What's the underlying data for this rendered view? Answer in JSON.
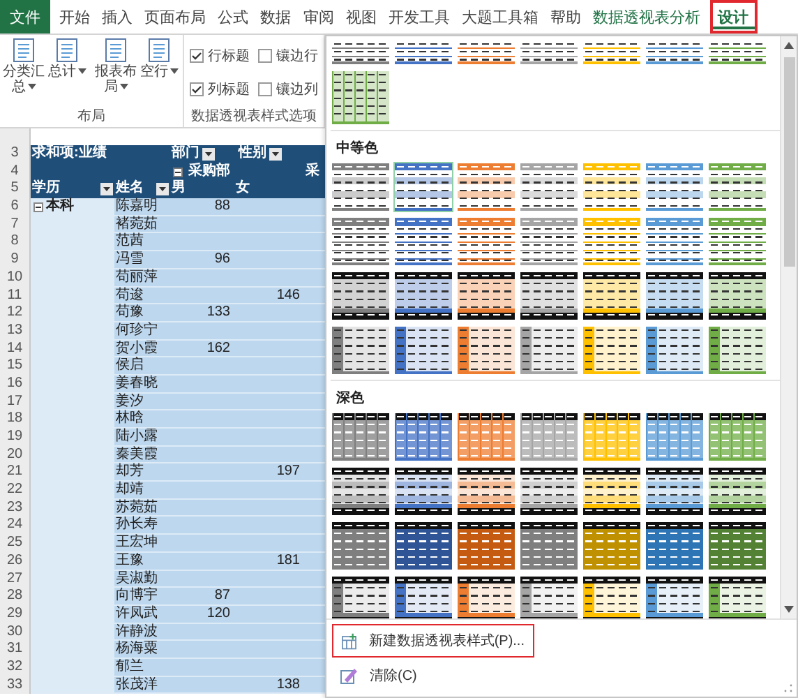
{
  "tabs": [
    {
      "label": "文件",
      "kind": "file",
      "selected": false,
      "highlighted": false
    },
    {
      "label": "开始",
      "kind": "normal",
      "selected": false,
      "highlighted": false
    },
    {
      "label": "插入",
      "kind": "normal",
      "selected": false,
      "highlighted": false
    },
    {
      "label": "页面布局",
      "kind": "normal",
      "selected": false,
      "highlighted": false
    },
    {
      "label": "公式",
      "kind": "normal",
      "selected": false,
      "highlighted": false
    },
    {
      "label": "数据",
      "kind": "normal",
      "selected": false,
      "highlighted": false
    },
    {
      "label": "审阅",
      "kind": "normal",
      "selected": false,
      "highlighted": false
    },
    {
      "label": "视图",
      "kind": "normal",
      "selected": false,
      "highlighted": false
    },
    {
      "label": "开发工具",
      "kind": "normal",
      "selected": false,
      "highlighted": false
    },
    {
      "label": "大题工具箱",
      "kind": "normal",
      "selected": false,
      "highlighted": false
    },
    {
      "label": "帮助",
      "kind": "normal",
      "selected": false,
      "highlighted": false
    },
    {
      "label": "数据透视表分析",
      "kind": "contextual",
      "selected": false,
      "highlighted": false
    },
    {
      "label": "设计",
      "kind": "contextual",
      "selected": true,
      "highlighted": true
    }
  ],
  "ribbon": {
    "layout_group": {
      "label": "布局",
      "buttons": [
        {
          "label": "分类汇总"
        },
        {
          "label": "总计"
        },
        {
          "label": "报表布局"
        },
        {
          "label": "空行"
        }
      ]
    },
    "options_group": {
      "label": "数据透视表样式选项",
      "options": [
        {
          "label": "行标题",
          "checked": true
        },
        {
          "label": "镶边行",
          "checked": false
        },
        {
          "label": "列标题",
          "checked": true
        },
        {
          "label": "镶边列",
          "checked": false
        }
      ]
    }
  },
  "pivot": {
    "value_field": "求和项:业绩",
    "column_fields": [
      "部门",
      "性别"
    ],
    "department": {
      "label": "采购部",
      "expanded": true
    },
    "next_department": "采",
    "row_fields": [
      "学历",
      "姓名"
    ],
    "genders": [
      "男",
      "女"
    ],
    "header_row_numbers": [
      "3",
      "4",
      "5"
    ],
    "group": {
      "label": "本科",
      "expanded": true
    },
    "rows": [
      {
        "row": "6",
        "name": "陈嘉明",
        "male": "88"
      },
      {
        "row": "7",
        "name": "褚菀茹"
      },
      {
        "row": "8",
        "name": "范茜"
      },
      {
        "row": "9",
        "name": "冯雪",
        "male": "96"
      },
      {
        "row": "10",
        "name": "苟丽萍"
      },
      {
        "row": "11",
        "name": "苟逡",
        "female": "146"
      },
      {
        "row": "12",
        "name": "苟豫",
        "male": "133"
      },
      {
        "row": "13",
        "name": "何珍宁"
      },
      {
        "row": "14",
        "name": "贺小霞",
        "male": "162"
      },
      {
        "row": "15",
        "name": "侯启"
      },
      {
        "row": "16",
        "name": "姜春晓"
      },
      {
        "row": "17",
        "name": "姜汐"
      },
      {
        "row": "18",
        "name": "林晗"
      },
      {
        "row": "19",
        "name": "陆小露"
      },
      {
        "row": "20",
        "name": "秦美霞"
      },
      {
        "row": "21",
        "name": "却芳",
        "female": "197"
      },
      {
        "row": "22",
        "name": "却靖"
      },
      {
        "row": "23",
        "name": "苏菀茹"
      },
      {
        "row": "24",
        "name": "孙长寿"
      },
      {
        "row": "25",
        "name": "王宏坤"
      },
      {
        "row": "26",
        "name": "王豫",
        "female": "181"
      },
      {
        "row": "27",
        "name": "吴淑勤"
      },
      {
        "row": "28",
        "name": "向博宇",
        "male": "87"
      },
      {
        "row": "29",
        "name": "许凤武",
        "male": "120"
      },
      {
        "row": "30",
        "name": "许静波"
      },
      {
        "row": "31",
        "name": "杨海粟"
      },
      {
        "row": "32",
        "name": "郁兰"
      },
      {
        "row": "33",
        "name": "张茂洋",
        "female": "138"
      }
    ]
  },
  "gallery": {
    "sections": [
      {
        "rows": [
          {
            "kind": "light-lines",
            "thumbs": [
              {
                "color": "#7f7f7f",
                "selected": false
              },
              {
                "color": "#4472c4",
                "selected": false
              },
              {
                "color": "#ed7d31",
                "selected": false
              },
              {
                "color": "#a5a5a5",
                "selected": false
              },
              {
                "color": "#ffc000",
                "selected": false
              },
              {
                "color": "#5b9bd5",
                "selected": false
              },
              {
                "color": "#70ad47",
                "selected": false
              }
            ]
          },
          {
            "kind": "light-grid",
            "thumbs": [
              {
                "color": "#70ad47",
                "selected": false
              }
            ]
          }
        ]
      },
      {
        "label": "中等色",
        "rows": [
          {
            "kind": "banded",
            "thumbs": [
              {
                "color": "#7f7f7f",
                "selected": false
              },
              {
                "color": "#4472c4",
                "selected": true
              },
              {
                "color": "#ed7d31",
                "selected": false
              },
              {
                "color": "#a5a5a5",
                "selected": false
              },
              {
                "color": "#ffc000",
                "selected": false
              },
              {
                "color": "#5b9bd5",
                "selected": false
              },
              {
                "color": "#70ad47",
                "selected": false
              }
            ]
          },
          {
            "kind": "header-lines",
            "thumbs": [
              {
                "color": "#7f7f7f",
                "selected": false
              },
              {
                "color": "#4472c4",
                "selected": false
              },
              {
                "color": "#ed7d31",
                "selected": false
              },
              {
                "color": "#a5a5a5",
                "selected": false
              },
              {
                "color": "#ffc000",
                "selected": false
              },
              {
                "color": "#5b9bd5",
                "selected": false
              },
              {
                "color": "#70ad47",
                "selected": false
              }
            ]
          },
          {
            "kind": "black-header",
            "thumbs": [
              {
                "color": "#7f7f7f",
                "selected": false
              },
              {
                "color": "#4472c4",
                "selected": false
              },
              {
                "color": "#ed7d31",
                "selected": false
              },
              {
                "color": "#a5a5a5",
                "selected": false
              },
              {
                "color": "#ffc000",
                "selected": false
              },
              {
                "color": "#5b9bd5",
                "selected": false
              },
              {
                "color": "#70ad47",
                "selected": false
              }
            ]
          },
          {
            "kind": "first-column",
            "thumbs": [
              {
                "color": "#7f7f7f",
                "selected": false
              },
              {
                "color": "#4472c4",
                "selected": false
              },
              {
                "color": "#ed7d31",
                "selected": false
              },
              {
                "color": "#a5a5a5",
                "selected": false
              },
              {
                "color": "#ffc000",
                "selected": false
              },
              {
                "color": "#5b9bd5",
                "selected": false
              },
              {
                "color": "#70ad47",
                "selected": false
              }
            ]
          }
        ]
      },
      {
        "label": "深色",
        "rows": [
          {
            "kind": "dark-grid",
            "thumbs": [
              {
                "color": "#7f7f7f",
                "selected": false
              },
              {
                "color": "#4472c4",
                "selected": false
              },
              {
                "color": "#ed7d31",
                "selected": false
              },
              {
                "color": "#a5a5a5",
                "selected": false
              },
              {
                "color": "#ffc000",
                "selected": false
              },
              {
                "color": "#5b9bd5",
                "selected": false
              },
              {
                "color": "#70ad47",
                "selected": false
              }
            ]
          },
          {
            "kind": "dark-light",
            "thumbs": [
              {
                "color": "#7f7f7f",
                "selected": false
              },
              {
                "color": "#4472c4",
                "selected": false
              },
              {
                "color": "#ed7d31",
                "selected": false
              },
              {
                "color": "#a5a5a5",
                "selected": false
              },
              {
                "color": "#ffc000",
                "selected": false
              },
              {
                "color": "#5b9bd5",
                "selected": false
              },
              {
                "color": "#70ad47",
                "selected": false
              }
            ]
          },
          {
            "kind": "dark-solid",
            "thumbs": [
              {
                "color": "#7f7f7f",
                "selected": false
              },
              {
                "color": "#2f5597",
                "selected": false
              },
              {
                "color": "#c55a11",
                "selected": false
              },
              {
                "color": "#7f7f7f",
                "selected": false
              },
              {
                "color": "#bf9000",
                "selected": false
              },
              {
                "color": "#2e75b6",
                "selected": false
              },
              {
                "color": "#548235",
                "selected": false
              }
            ]
          },
          {
            "kind": "dark-banded",
            "thumbs": [
              {
                "color": "#7f7f7f",
                "selected": false
              },
              {
                "color": "#4472c4",
                "selected": false
              },
              {
                "color": "#ed7d31",
                "selected": false
              },
              {
                "color": "#a5a5a5",
                "selected": false
              },
              {
                "color": "#ffc000",
                "selected": false
              },
              {
                "color": "#5b9bd5",
                "selected": false
              },
              {
                "color": "#70ad47",
                "selected": false
              }
            ]
          }
        ]
      }
    ],
    "menu": [
      {
        "label": "新建数据透视表样式(P)...",
        "kind": "new-style",
        "highlighted": true
      },
      {
        "label": "清除(C)",
        "kind": "clear",
        "highlighted": false
      }
    ]
  }
}
